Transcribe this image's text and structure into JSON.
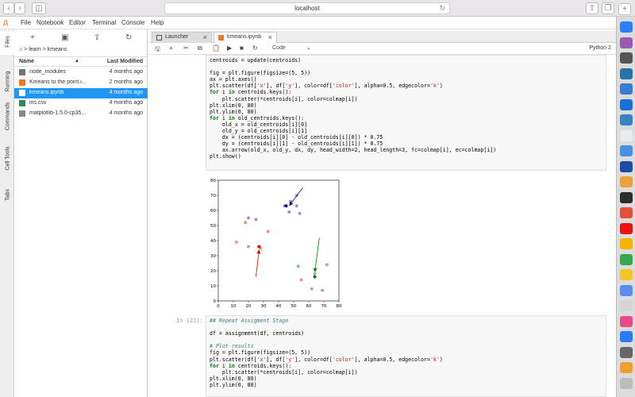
{
  "browser": {
    "url": "localhost"
  },
  "menu": {
    "logo": "д",
    "items": [
      "File",
      "Notebook",
      "Editor",
      "Terminal",
      "Console",
      "Help"
    ]
  },
  "sidebar_tabs": [
    "Files",
    "Running",
    "Commands",
    "Cell Tools",
    "Tabs"
  ],
  "filebrowser": {
    "breadcrumb": "⌂ > learn > kmeans",
    "col_name": "Name",
    "col_modified": "Last Modified",
    "sort_arrow": "▲",
    "files": [
      {
        "name": "node_modules",
        "modified": "4 months ago",
        "type": "folder",
        "selected": false
      },
      {
        "name": "Kmeans to the point.i...",
        "modified": "2 months ago",
        "type": "notebook",
        "selected": false
      },
      {
        "name": "kmeans.ipynb",
        "modified": "4 months ago",
        "type": "notebook",
        "selected": true
      },
      {
        "name": "iris.csv",
        "modified": "4 months ago",
        "type": "csv",
        "selected": false
      },
      {
        "name": "matplotlib-1.5.0-cp35...",
        "modified": "4 months ago",
        "type": "file",
        "selected": false
      }
    ]
  },
  "tabs": [
    {
      "label": "Launcher",
      "active": false
    },
    {
      "label": "kmeans.ipynb",
      "active": true
    }
  ],
  "toolbar": {
    "cell_type": "Code",
    "kernel": "Python 2"
  },
  "cell1": {
    "lines": [
      "centroids = update(centroids)",
      "",
      "fig = plt.figure(figsize=(5, 5))",
      "ax = plt.axes()",
      "plt.scatter(df['x'], df['y'], color=df['color'], alpha=0.5, edgecolor='k')",
      "for i in centroids.keys():",
      "    plt.scatter(*centroids[i], color=colmap[i])",
      "plt.xlim(0, 80)",
      "plt.ylim(0, 80)",
      "for i in old_centroids.keys():",
      "    old_x = old_centroids[i][0]",
      "    old_y = old_centroids[i][1]",
      "    dx = (centroids[i][0] - old_centroids[i][0]) * 0.75",
      "    dy = (centroids[i][1] - old_centroids[i][1]) * 0.75",
      "    ax.arrow(old_x, old_y, dx, dy, head_width=2, head_length=3, fc=colmap[i], ec=colmap[i])",
      "plt.show()"
    ]
  },
  "cell2": {
    "prompt": "In [22]:",
    "lines": [
      "## Repeat Assigment Stage",
      "",
      "df = assignment(df, centroids)",
      "",
      "# Plot results",
      "fig = plt.figure(figsize=(5, 5))",
      "plt.scatter(df['x'], df['y'], color=df['color'], alpha=0.5, edgecolor='k')",
      "for i in centroids.keys():",
      "    plt.scatter(*centroids[i], color=colmap[i])",
      "plt.xlim(0, 80)",
      "plt.ylim(0, 80)"
    ]
  },
  "chart_data": {
    "type": "scatter",
    "xlim": [
      0,
      80
    ],
    "ylim": [
      0,
      80
    ],
    "ticks": [
      0,
      10,
      20,
      30,
      40,
      50,
      60,
      70,
      80
    ],
    "series": [
      {
        "color": "#e04040",
        "points": [
          [
            12,
            39
          ],
          [
            18,
            52
          ],
          [
            20,
            36
          ],
          [
            28,
            35
          ],
          [
            33,
            46
          ],
          [
            55,
            14
          ]
        ]
      },
      {
        "color": "#2a9d2a",
        "points": [
          [
            53,
            23
          ],
          [
            62,
            8
          ],
          [
            64,
            18
          ],
          [
            69,
            7
          ],
          [
            72,
            24
          ]
        ]
      },
      {
        "color": "#3c3cd0",
        "points": [
          [
            20,
            55
          ],
          [
            25,
            54
          ],
          [
            44,
            63
          ],
          [
            47,
            59
          ],
          [
            48,
            66
          ],
          [
            52,
            63
          ],
          [
            52,
            70
          ],
          [
            54,
            58
          ]
        ]
      }
    ],
    "centroids": [
      {
        "color": "#e00000",
        "x": 27,
        "y": 36
      },
      {
        "color": "#008000",
        "x": 64,
        "y": 16
      },
      {
        "color": "#0000b0",
        "x": 45,
        "y": 63
      }
    ],
    "arrows": [
      {
        "color": "#e00000",
        "from": [
          25,
          16
        ],
        "to": [
          27,
          34
        ]
      },
      {
        "color": "#008000",
        "from": [
          67,
          42
        ],
        "to": [
          64,
          19
        ]
      },
      {
        "color": "#0000b0",
        "from": [
          56,
          75
        ],
        "to": [
          47,
          63
        ]
      }
    ]
  },
  "dock": {
    "colors": [
      "#2d7ff9",
      "#9b59b6",
      "#555",
      "#2874a6",
      "#3a7bd5",
      "#1c6fd6",
      "#3b82c4",
      "#e9ecef",
      "#4a90e2",
      "#1e4aa8",
      "#e8a33d",
      "#2c2c2c",
      "#e74c3c",
      "#ee1111",
      "#f4b400",
      "#36a852",
      "#f7c325",
      "#5b8def",
      "#d4d4d4",
      "#e94b8a",
      "#2b7bff",
      "#666",
      "#f0a030",
      "#bbb"
    ]
  }
}
